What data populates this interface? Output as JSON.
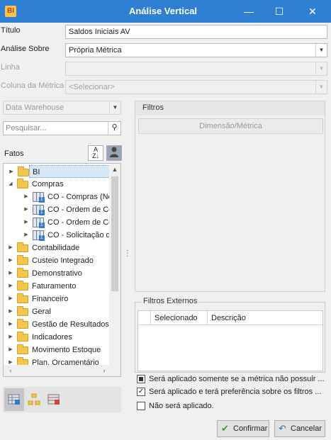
{
  "window": {
    "app_icon": "BI",
    "title": "Análise Vertical",
    "minimize": "—",
    "maximize": "☐",
    "close": "✕"
  },
  "form": {
    "titulo_label": "Título",
    "titulo_value": "Saldos Iniciais AV",
    "analise_label": "Análise Sobre",
    "analise_value": "Própria Métrica",
    "linha_label": "Linha",
    "linha_value": "",
    "coluna_label": "Coluna da Métrica",
    "coluna_value": "<Selecionar>"
  },
  "left": {
    "source_value": "Data Warehouse",
    "search_placeholder": "Pesquisar...",
    "fatos_label": "Fatos",
    "sort_icon": "sort-az-icon",
    "user_icon": "user-icon",
    "tree": [
      {
        "label": "BI",
        "level": 0,
        "type": "folder",
        "expanded": false,
        "selected": true
      },
      {
        "label": "Compras",
        "level": 0,
        "type": "folder",
        "expanded": true
      },
      {
        "label": "CO - Compras (Not",
        "level": 1,
        "type": "cube"
      },
      {
        "label": "CO - Ordem de Cor",
        "level": 1,
        "type": "cube"
      },
      {
        "label": "CO - Ordem de Cor",
        "level": 1,
        "type": "cube"
      },
      {
        "label": "CO - Solicitação de",
        "level": 1,
        "type": "cube"
      },
      {
        "label": "Contabilidade",
        "level": 0,
        "type": "folder"
      },
      {
        "label": "Custeio Integrado",
        "level": 0,
        "type": "folder"
      },
      {
        "label": "Demonstrativo",
        "level": 0,
        "type": "folder"
      },
      {
        "label": "Faturamento",
        "level": 0,
        "type": "folder"
      },
      {
        "label": "Financeiro",
        "level": 0,
        "type": "folder"
      },
      {
        "label": "Geral",
        "level": 0,
        "type": "folder"
      },
      {
        "label": "Gestão de Resultados",
        "level": 0,
        "type": "folder"
      },
      {
        "label": "Indicadores",
        "level": 0,
        "type": "folder"
      },
      {
        "label": "Movimento Estoque",
        "level": 0,
        "type": "folder"
      },
      {
        "label": "Plan. Orçamentário",
        "level": 0,
        "type": "folder"
      }
    ]
  },
  "filtros": {
    "header": "Filtros",
    "dim_button": "Dimensão/Métrica"
  },
  "externos": {
    "title": "Filtros Externos",
    "columns": [
      "Selecionado",
      "Descrição"
    ],
    "options": [
      {
        "label": "Será aplicado somente se a métrica não possuir ...",
        "state": "indeterminate"
      },
      {
        "label": "Será aplicado e terá preferência sobre os filtros ...",
        "state": "checked"
      },
      {
        "label": "Não será aplicado.",
        "state": "unchecked"
      }
    ]
  },
  "buttons": {
    "confirm": "Confirmar",
    "cancel": "Cancelar"
  },
  "colors": {
    "titlebar": "#2f7fd2",
    "folder": "#f2c64f",
    "confirm_icon": "#3a9b3a",
    "cancel_icon": "#2a6fc0"
  }
}
